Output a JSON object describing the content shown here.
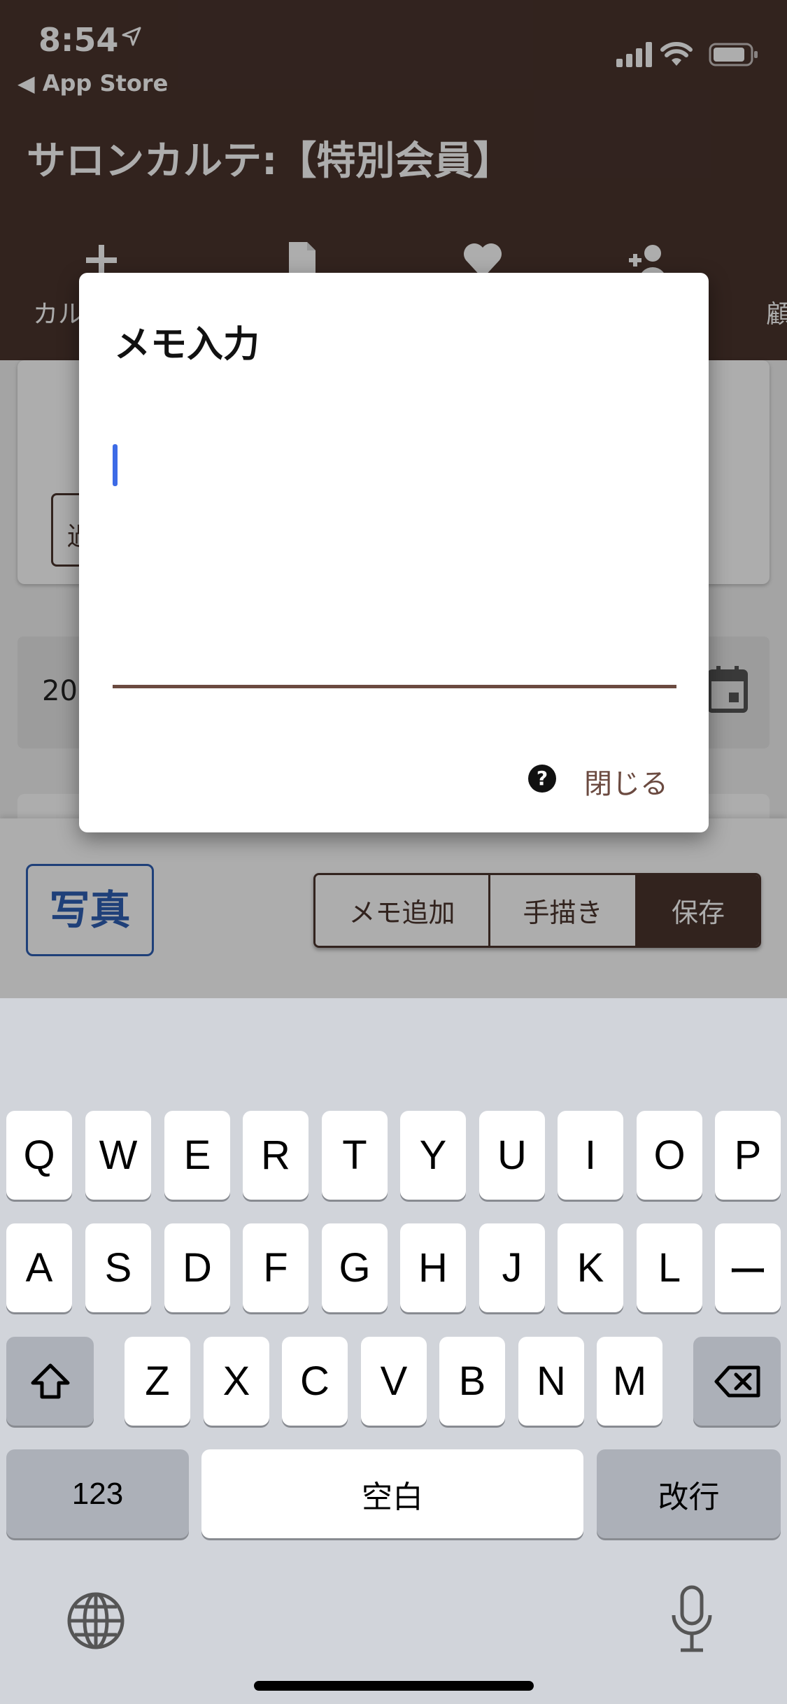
{
  "status_bar": {
    "time": "8:54",
    "back_label": "◀ App Store"
  },
  "header": {
    "title": "サロンカルテ:【特別会員】"
  },
  "nav": {
    "items": [
      {
        "label": "カル"
      },
      {
        "label": ""
      },
      {
        "label": ""
      },
      {
        "label": ""
      },
      {
        "label": "顧"
      }
    ]
  },
  "content": {
    "history_button": "過",
    "date_prefix": "20"
  },
  "toolbar": {
    "photo_label": "写真",
    "memo_add": "メモ追加",
    "draw": "手描き",
    "save": "保存"
  },
  "dialog": {
    "title": "メモ入力",
    "input_value": "",
    "help_glyph": "?",
    "close_label": "閉じる"
  },
  "keyboard": {
    "row1": [
      "Q",
      "W",
      "E",
      "R",
      "T",
      "Y",
      "U",
      "I",
      "O",
      "P"
    ],
    "row2": [
      "A",
      "S",
      "D",
      "F",
      "G",
      "H",
      "J",
      "K",
      "L",
      "ー"
    ],
    "row3": [
      "Z",
      "X",
      "C",
      "V",
      "B",
      "N",
      "M"
    ],
    "numbers_key": "123",
    "space_key": "空白",
    "return_key": "改行"
  }
}
